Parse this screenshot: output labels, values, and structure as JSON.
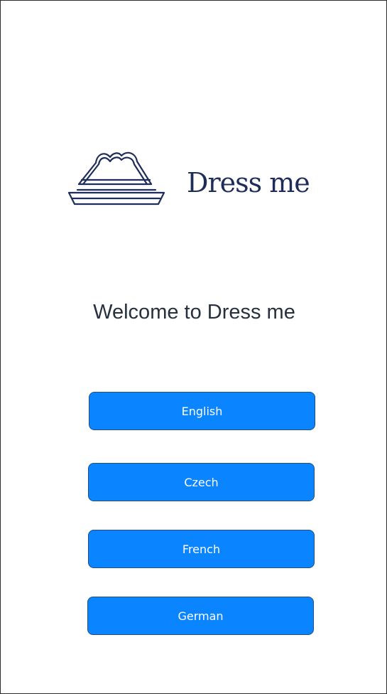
{
  "brand": {
    "name": "Dress me",
    "icon": "hat-logo-icon",
    "color": "#1f2d5a"
  },
  "welcome_text": "Welcome to Dress me",
  "languages": [
    {
      "label": "English"
    },
    {
      "label": "Czech"
    },
    {
      "label": "French"
    },
    {
      "label": "German"
    }
  ],
  "colors": {
    "button_background": "#0a84ff",
    "button_text": "#ffffff",
    "heading_text": "#27313d",
    "background": "#ffffff"
  }
}
